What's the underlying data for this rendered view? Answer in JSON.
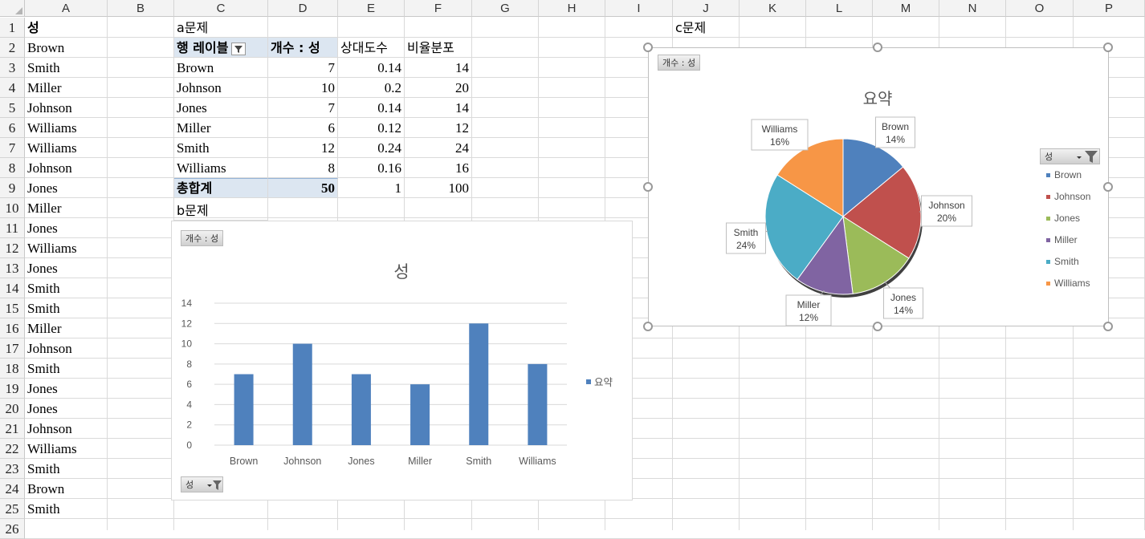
{
  "columns": [
    "A",
    "B",
    "C",
    "D",
    "E",
    "F",
    "G",
    "H",
    "I",
    "J",
    "K",
    "L",
    "M",
    "N",
    "O",
    "P"
  ],
  "rows": [
    "1",
    "2",
    "3",
    "4",
    "5",
    "6",
    "7",
    "8",
    "9",
    "10",
    "11",
    "12",
    "13",
    "14",
    "15",
    "16",
    "17",
    "18",
    "19",
    "20",
    "21",
    "22",
    "23",
    "24",
    "25",
    "26"
  ],
  "col_a": [
    "성",
    "Brown",
    "Smith",
    "Miller",
    "Johnson",
    "Williams",
    "Williams",
    "Johnson",
    "Jones",
    "Miller",
    "Jones",
    "Williams",
    "Jones",
    "Smith",
    "Smith",
    "Miller",
    "Johnson",
    "Smith",
    "Jones",
    "Jones",
    "Johnson",
    "Williams",
    "Smith",
    "Brown",
    "Smith"
  ],
  "labels": {
    "a": "a문제",
    "b": "b문제",
    "c": "c문제"
  },
  "pivot": {
    "header_row_label": "행 레이블",
    "header_count": "개수 : 성",
    "header_rel": "상대도수",
    "header_ratio": "비율분포",
    "rows": [
      {
        "name": "Brown",
        "count": "7",
        "rel": "0.14",
        "ratio": "14"
      },
      {
        "name": "Johnson",
        "count": "10",
        "rel": "0.2",
        "ratio": "20"
      },
      {
        "name": "Jones",
        "count": "7",
        "rel": "0.14",
        "ratio": "14"
      },
      {
        "name": "Miller",
        "count": "6",
        "rel": "0.12",
        "ratio": "12"
      },
      {
        "name": "Smith",
        "count": "12",
        "rel": "0.24",
        "ratio": "24"
      },
      {
        "name": "Williams",
        "count": "8",
        "rel": "0.16",
        "ratio": "16"
      }
    ],
    "total_label": "총합계",
    "total_count": "50",
    "total_rel": "1",
    "total_ratio": "100"
  },
  "bar_chart": {
    "field_button": "개수 : 성",
    "axis_field_button": "성",
    "legend": "요약",
    "color": "#4f81bd"
  },
  "pie_chart": {
    "field_button": "개수 : 성",
    "legend_field_button": "성"
  },
  "chart_data": [
    {
      "type": "bar",
      "title": "성",
      "categories": [
        "Brown",
        "Johnson",
        "Jones",
        "Miller",
        "Smith",
        "Williams"
      ],
      "series": [
        {
          "name": "요약",
          "values": [
            7,
            10,
            7,
            6,
            12,
            8
          ]
        }
      ],
      "yticks": [
        "0",
        "2",
        "4",
        "6",
        "8",
        "10",
        "12",
        "14"
      ],
      "ylim": [
        0,
        14
      ],
      "grid": true,
      "legend": "right"
    },
    {
      "type": "pie",
      "title": "요약",
      "categories": [
        "Brown",
        "Johnson",
        "Jones",
        "Miller",
        "Smith",
        "Williams"
      ],
      "values": [
        7,
        10,
        7,
        6,
        12,
        8
      ],
      "percent_labels": [
        "14%",
        "20%",
        "14%",
        "12%",
        "24%",
        "16%"
      ],
      "colors": [
        "#4f81bd",
        "#c0504d",
        "#9bbb59",
        "#8064a2",
        "#4bacc6",
        "#f79646"
      ],
      "legend": "right"
    }
  ]
}
